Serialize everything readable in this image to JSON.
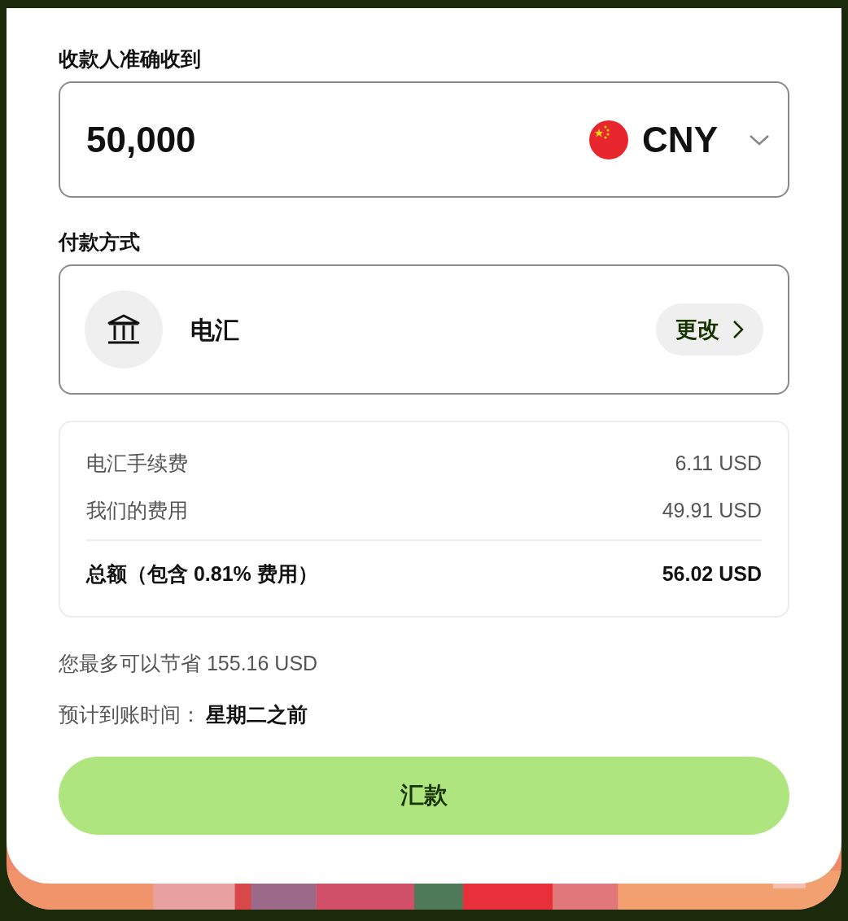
{
  "amount": {
    "label": "收款人准确收到",
    "value": "50,000",
    "currency": "CNY"
  },
  "payment": {
    "label": "付款方式",
    "method": "电汇",
    "change_button": "更改"
  },
  "fees": {
    "rows": [
      {
        "label": "电汇手续费",
        "value": "6.11 USD"
      },
      {
        "label": "我们的费用",
        "value": "49.91 USD"
      }
    ],
    "total": {
      "label": "总额（包含 0.81% 费用）",
      "value": "56.02 USD"
    }
  },
  "savings": "您最多可以节省 155.16 USD",
  "eta": {
    "label": "预计到账时间：",
    "value": "星期二之前"
  },
  "submit_button": "汇款"
}
